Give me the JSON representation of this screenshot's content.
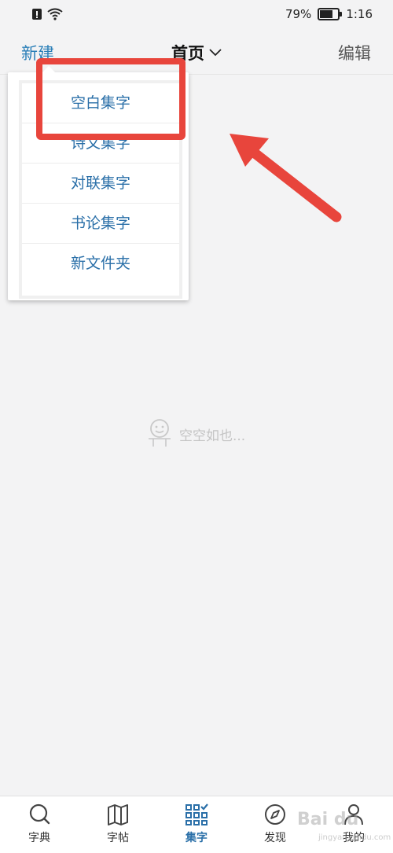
{
  "status": {
    "battery_text": "79%",
    "battery_level": 0.79,
    "time": "1:16"
  },
  "header": {
    "left_label": "新建",
    "title": "首页",
    "right_label": "编辑"
  },
  "dropdown": {
    "items": [
      {
        "label": "空白集字"
      },
      {
        "label": "诗文集字"
      },
      {
        "label": "对联集字"
      },
      {
        "label": "书论集字"
      },
      {
        "label": "新文件夹"
      }
    ]
  },
  "empty_state": {
    "text": "空空如也..."
  },
  "tabs": [
    {
      "label": "字典",
      "icon": "search-icon"
    },
    {
      "label": "字帖",
      "icon": "map-icon"
    },
    {
      "label": "集字",
      "icon": "grid-check-icon",
      "active": true
    },
    {
      "label": "发现",
      "icon": "compass-icon"
    },
    {
      "label": "我的",
      "icon": "user-icon"
    }
  ],
  "watermark": {
    "text": "Bai du",
    "sub": "jingyan.baidu.com"
  },
  "colors": {
    "accent": "#2a6fa8",
    "highlight": "#e8453c",
    "background": "#f3f3f4"
  }
}
